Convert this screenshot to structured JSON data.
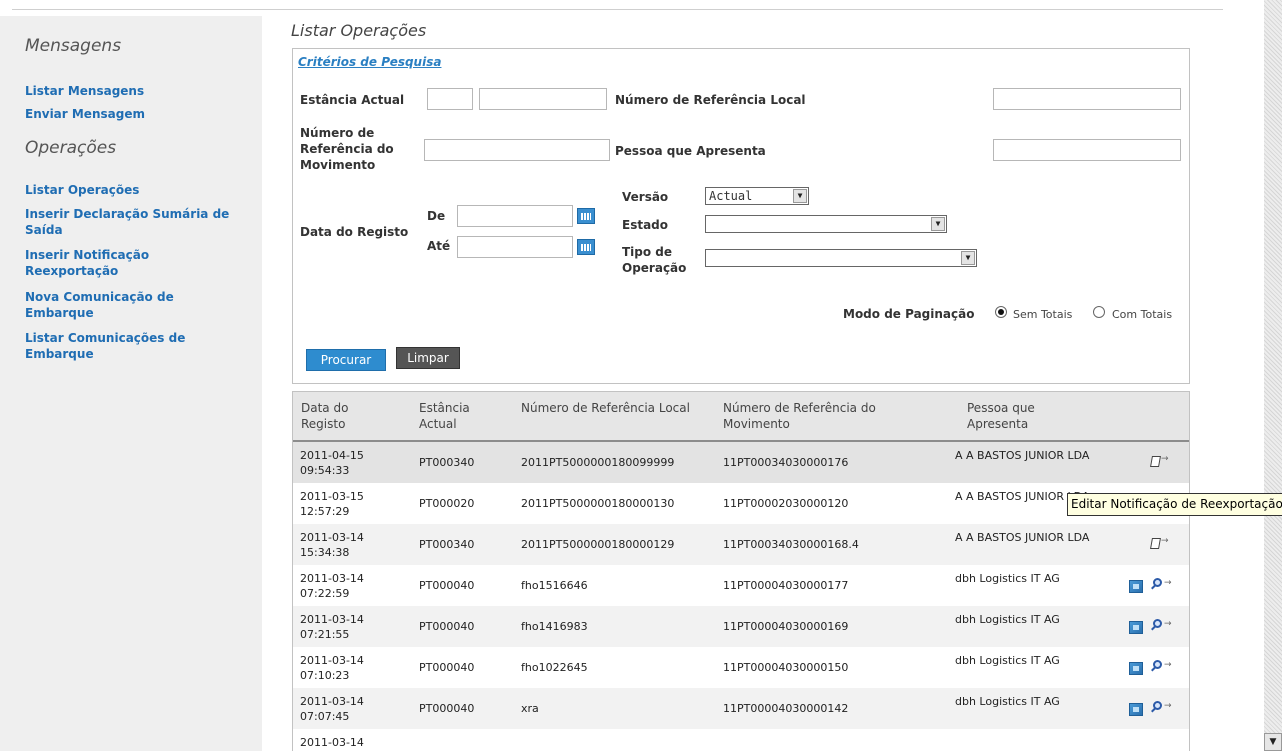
{
  "sidebar": {
    "heading_messages": "Mensagens",
    "messages_links": [
      "Listar Mensagens",
      "Enviar Mensagem"
    ],
    "heading_operations": "Operações",
    "operations_links": [
      "Listar Operações",
      "Inserir Declaração Sumária de Saída",
      "Inserir Notificação Reexportação",
      "Nova Comunicação de Embarque",
      "Listar Comunicações de Embarque"
    ]
  },
  "page_title": "Listar Operações",
  "search": {
    "title": "Critérios de Pesquisa",
    "estancia_actual_label": "Estância Actual",
    "num_ref_local_label": "Número de Referência Local",
    "num_ref_movimento_label": "Número de Referência do Movimento",
    "pessoa_label": "Pessoa que Apresenta",
    "data_registo_label": "Data do Registo",
    "de_label": "De",
    "ate_label": "Até",
    "versao_label": "Versão",
    "versao_value": "Actual",
    "estado_label": "Estado",
    "estado_value": "",
    "tipo_label": "Tipo de Operação",
    "tipo_value": "",
    "modo_label": "Modo de Paginação",
    "modo_options": [
      "Sem Totais",
      "Com Totais"
    ],
    "modo_selected": "Sem Totais",
    "procurar_label": "Procurar",
    "limpar_label": "Limpar"
  },
  "table": {
    "headers": [
      "Data do Registo",
      "Estância Actual",
      "Número de Referência Local",
      "Número de Referência do Movimento",
      "Pessoa que Apresenta"
    ],
    "rows": [
      {
        "date": "2011-04-15 09:54:33",
        "estancia": "PT000340",
        "ref_local": "2011PT5000000180099999",
        "ref_mov": "11PT00034030000176",
        "pessoa": "A A BASTOS JUNIOR LDA",
        "actions": [
          "edit"
        ]
      },
      {
        "date": "2011-03-15 12:57:29",
        "estancia": "PT000020",
        "ref_local": "2011PT5000000180000130",
        "ref_mov": "11PT00002030000120",
        "pessoa": "A A BASTOS JUNIOR LDA",
        "actions": []
      },
      {
        "date": "2011-03-14 15:34:38",
        "estancia": "PT000340",
        "ref_local": "2011PT5000000180000129",
        "ref_mov": "11PT00034030000168.4",
        "pessoa": "A A BASTOS JUNIOR LDA",
        "actions": [
          "edit"
        ]
      },
      {
        "date": "2011-03-14 07:22:59",
        "estancia": "PT000040",
        "ref_local": "fho1516646",
        "ref_mov": "11PT00004030000177",
        "pessoa": "dbh Logistics IT AG",
        "actions": [
          "doc",
          "search"
        ]
      },
      {
        "date": "2011-03-14 07:21:55",
        "estancia": "PT000040",
        "ref_local": "fho1416983",
        "ref_mov": "11PT00004030000169",
        "pessoa": "dbh Logistics IT AG",
        "actions": [
          "doc",
          "search"
        ]
      },
      {
        "date": "2011-03-14 07:10:23",
        "estancia": "PT000040",
        "ref_local": "fho1022645",
        "ref_mov": "11PT00004030000150",
        "pessoa": "dbh Logistics IT AG",
        "actions": [
          "doc",
          "search"
        ]
      },
      {
        "date": "2011-03-14 07:07:45",
        "estancia": "PT000040",
        "ref_local": "xra",
        "ref_mov": "11PT00004030000142",
        "pessoa": "dbh Logistics IT AG",
        "actions": [
          "doc",
          "search"
        ]
      },
      {
        "date": "2011-03-14",
        "estancia": "",
        "ref_local": "",
        "ref_mov": "",
        "pessoa": "",
        "actions": []
      }
    ]
  },
  "tooltip": "Editar Notificação de Reexportação",
  "icons": {
    "edit": "edit-pencil-icon",
    "doc": "document-icon",
    "search": "search-icon",
    "calendar": "calendar-icon"
  },
  "colors": {
    "link": "#1f6db3",
    "accent": "#2e8ccf",
    "sidebar_bg": "#efefef"
  }
}
